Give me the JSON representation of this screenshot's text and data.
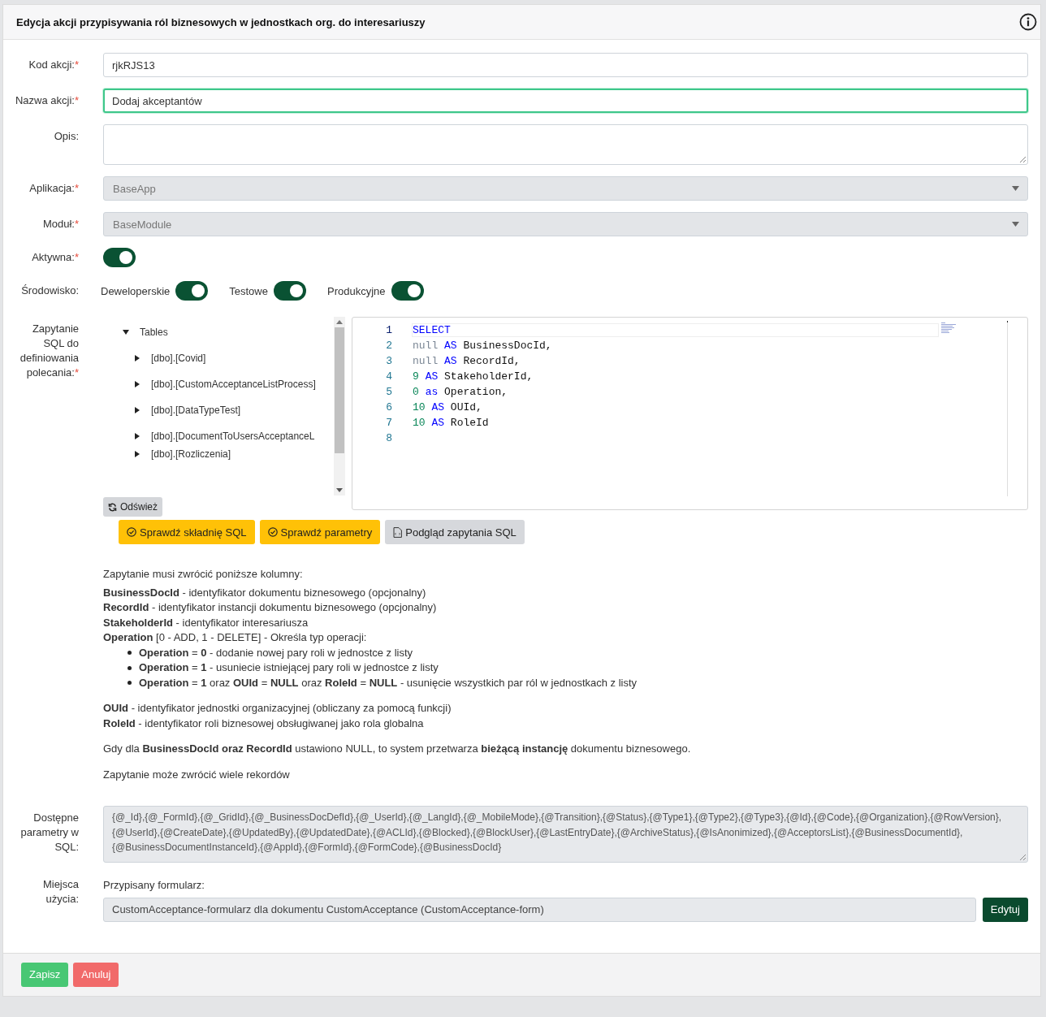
{
  "dialog": {
    "title": "Edycja akcji przypisywania ról biznesowych w jednostkach org. do interesariuszy"
  },
  "fields": [
    {
      "kind": "input",
      "label": "Kod akcji:",
      "mark": "*",
      "value": "rjkRJS13",
      "focused": false
    },
    {
      "kind": "input",
      "label": "Nazwa akcji:",
      "mark": "*",
      "value": "Dodaj akceptantów",
      "focused": true
    },
    {
      "kind": "textarea",
      "label": "Opis:"
    },
    {
      "kind": "select",
      "label": "Aplikacja:",
      "mark": "*",
      "value": "BaseApp",
      "disabled": true
    },
    {
      "kind": "select",
      "label": "Moduł:",
      "mark": "*",
      "value": "BaseModule",
      "disabled": true
    },
    {
      "kind": "toggle",
      "label": "Aktywna:",
      "mark": "*",
      "on": true
    },
    {
      "kind": "toggles",
      "label": "Środowisko:",
      "toggles": [
        {
          "label": "Deweloperskie",
          "on": true
        },
        {
          "label": "Testowe",
          "on": true
        },
        {
          "label": "Produkcyjne",
          "on": true
        }
      ]
    }
  ],
  "sql": {
    "label": "Zapytanie SQL do definiowania polecania:",
    "mark": "*",
    "tree": {
      "label": "Tables",
      "expanded": true,
      "children": [
        {
          "label": "[dbo].[Covid]",
          "expanded": false
        },
        {
          "label": "[dbo].[CustomAcceptanceListProcess]",
          "expanded": false
        },
        {
          "label": "[dbo].[DataTypeTest]",
          "expanded": false
        },
        {
          "label": "[dbo].[DocumentToUsersAcceptanceL",
          "expanded": false
        },
        {
          "label": "[dbo].[Rozliczenia]",
          "expanded": false
        }
      ]
    },
    "refresh_button": "Odśwież",
    "code_lines": [
      {
        "number": "1",
        "tokens": [
          {
            "kind": "keyword",
            "text": "SELECT"
          }
        ]
      },
      {
        "number": "2",
        "tokens": [
          {
            "kind": "null",
            "text": "null"
          },
          {
            "kind": "keyword",
            "text": "AS"
          },
          {
            "kind": "ident",
            "text": "BusinessDocId,"
          }
        ]
      },
      {
        "number": "3",
        "tokens": [
          {
            "kind": "null",
            "text": "null"
          },
          {
            "kind": "keyword",
            "text": "AS"
          },
          {
            "kind": "ident",
            "text": "RecordId,"
          }
        ]
      },
      {
        "number": "4",
        "tokens": [
          {
            "kind": "number",
            "text": "9"
          },
          {
            "kind": "keyword",
            "text": "AS"
          },
          {
            "kind": "ident",
            "text": "StakeholderId,"
          }
        ]
      },
      {
        "number": "5",
        "tokens": [
          {
            "kind": "number",
            "text": "0"
          },
          {
            "kind": "keyword",
            "text": "as"
          },
          {
            "kind": "ident",
            "text": "Operation,"
          }
        ]
      },
      {
        "number": "6",
        "tokens": [
          {
            "kind": "number",
            "text": "10"
          },
          {
            "kind": "keyword",
            "text": "AS"
          },
          {
            "kind": "ident",
            "text": "OUId,"
          }
        ]
      },
      {
        "number": "7",
        "tokens": [
          {
            "kind": "number",
            "text": "10"
          },
          {
            "kind": "keyword",
            "text": "AS"
          },
          {
            "kind": "ident",
            "text": "RoleId"
          }
        ]
      },
      {
        "number": "8"
      }
    ],
    "buttons": [
      {
        "label": "Sprawdź składnię SQL",
        "kind": "warning"
      },
      {
        "label": "Sprawdź parametry",
        "kind": "warning"
      },
      {
        "label": "Podgląd zapytania SQL",
        "kind": "secondary"
      }
    ]
  },
  "help": {
    "intro": "Zapytanie musi zwrócić poniższe kolumny:",
    "columns": [
      "**BusinessDocId** - identyfikator dokumentu biznesowego (opcjonalny)",
      "**RecordId** - identyfikator instancji dokumentu biznesowego (opcjonalny)",
      "**StakeholderId** - identyfikator interesariusza",
      "**Operation** [0 - ADD, 1 - DELETE] - Określa typ operacji:"
    ],
    "bullets": [
      "**Operation** = **0** - dodanie nowej pary roli w jednostce z listy",
      "**Operation** = **1** - usuniecie istniejącej pary roli w jednostce z listy",
      "**Operation** = **1** oraz **OUId** = **NULL** oraz **RoleId** = **NULL** - usunięcie wszystkich par ról w jednostkach z listy"
    ],
    "more_columns": [
      "**OUId** - identyfikator jednostki organizacyjnej (obliczany za pomocą funkcji)",
      "**RoleId** - identyfikator roli biznesowej obsługiwanej jako rola globalna"
    ],
    "notes": [
      "Gdy dla **BusinessDocId oraz RecordId** ustawiono NULL, to system przetwarza **bieżącą instancję** dokumentu biznesowego.",
      "Zapytanie może zwrócić wiele rekordów"
    ]
  },
  "params": {
    "label": "Dostępne parametry w SQL:",
    "value": "{@_Id},{@_FormId},{@_GridId},{@_BusinessDocDefId},{@_UserId},{@_LangId},{@_MobileMode},{@Transition},{@Status},{@Type1},{@Type2},{@Type3},{@Id},{@Code},{@Organization},{@RowVersion},{@UserId},{@CreateDate},{@UpdatedBy},{@UpdatedDate},{@ACLId},{@Blocked},{@BlockUser},{@LastEntryDate},{@ArchiveStatus},{@IsAnonimized},{@AcceptorsList},{@BusinessDocumentId},{@BusinessDocumentInstanceId},{@AppId},{@FormId},{@FormCode},{@BusinessDocId}"
  },
  "usage": {
    "label": "Miejsca użycia:",
    "caption": "Przypisany formularz:",
    "value": "CustomAcceptance-formularz dla dokumentu CustomAcceptance (CustomAcceptance-form)",
    "button": "Edytuj"
  },
  "footer_buttons": [
    {
      "label": "Zapisz",
      "kind": "success"
    },
    {
      "label": "Anuluj",
      "kind": "danger"
    }
  ]
}
